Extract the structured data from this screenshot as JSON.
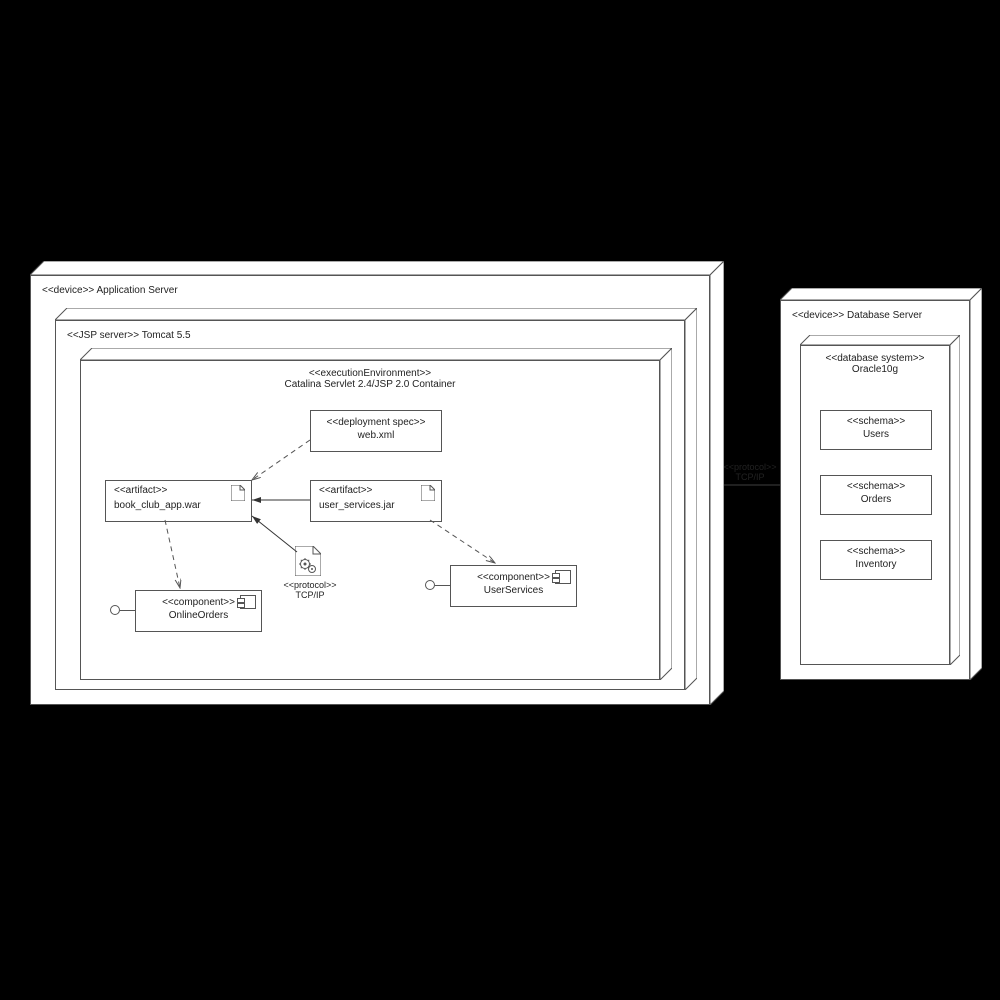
{
  "appServer": {
    "stereo": "<<device>>",
    "name": "Application Server",
    "jsp": {
      "stereo": "<<JSP server>>",
      "name": "Tomcat 5.5",
      "exec": {
        "stereo": "<<executionEnvironment>>",
        "name": "Catalina Servlet 2.4/JSP 2.0 Container",
        "deploySpec": {
          "stereo": "<<deployment spec>>",
          "name": "web.xml"
        },
        "artifactWar": {
          "stereo": "<<artifact>>",
          "name": "book_club_app.war"
        },
        "artifactJar": {
          "stereo": "<<artifact>>",
          "name": "user_services.jar"
        },
        "compOrders": {
          "stereo": "<<component>>",
          "name": "OnlineOrders"
        },
        "compUsers": {
          "stereo": "<<component>>",
          "name": "UserServices"
        },
        "protoFile": {
          "stereo": "<<protocol>>",
          "name": "TCP/IP"
        }
      }
    }
  },
  "dbServer": {
    "stereo": "<<device>>",
    "name": "Database Server",
    "dbSys": {
      "stereo": "<<database system>>",
      "name": "Oracle10g",
      "schemaUsers": {
        "stereo": "<<schema>>",
        "name": "Users"
      },
      "schemaOrders": {
        "stereo": "<<schema>>",
        "name": "Orders"
      },
      "schemaInv": {
        "stereo": "<<schema>>",
        "name": "Inventory"
      }
    }
  },
  "linkProto": {
    "stereo": "<<protocol>>",
    "name": "TCP/IP"
  }
}
